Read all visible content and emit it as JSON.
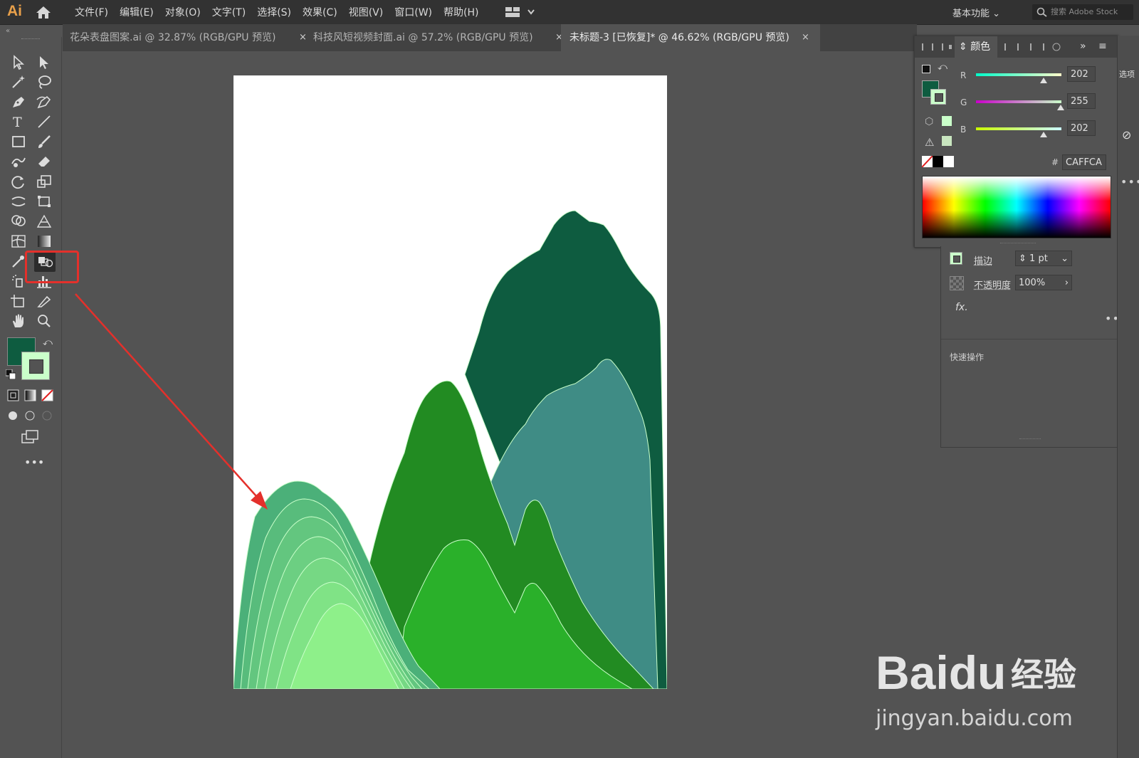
{
  "app": {
    "logo": "Ai",
    "workspace": "基本功能",
    "search_placeholder": "搜索 Adobe Stock"
  },
  "menu": [
    "文件(F)",
    "编辑(E)",
    "对象(O)",
    "文字(T)",
    "选择(S)",
    "效果(C)",
    "视图(V)",
    "窗口(W)",
    "帮助(H)"
  ],
  "tabs": [
    {
      "label": "花朵表盘图案.ai @ 32.87% (RGB/GPU 预览)",
      "active": false
    },
    {
      "label": "科技风短视频封面.ai @ 57.2% (RGB/GPU 预览)",
      "active": false
    },
    {
      "label": "未标题-3 [已恢复]* @ 46.62% (RGB/GPU 预览)",
      "active": true
    }
  ],
  "tab_close": "×",
  "color_panel": {
    "title": "颜色",
    "r_label": "R",
    "r_value": "202",
    "g_label": "G",
    "g_value": "255",
    "b_label": "B",
    "b_value": "202",
    "hex_prefix": "#",
    "hex_value": "CAFFCA"
  },
  "properties": {
    "stroke_label": "描边",
    "stroke_value": "1 pt",
    "opacity_label": "不透明度",
    "opacity_value": "100%",
    "fx_label": "fx.",
    "quick_actions": "快速操作",
    "options_label": "选项"
  },
  "watermark": {
    "brand": "Baidu",
    "brand_cn": "经验",
    "url": "jingyan.baidu.com"
  },
  "colors": {
    "fill": "#0e5c40",
    "stroke": "#caffca",
    "highlight": "#e4302b",
    "mountain_dark": "#0e5c40",
    "mountain_teal": "#3f8c85",
    "mountain_green": "#228b22",
    "mountain_bright": "#2ab02a",
    "mountain_light": "#8ef08a"
  }
}
